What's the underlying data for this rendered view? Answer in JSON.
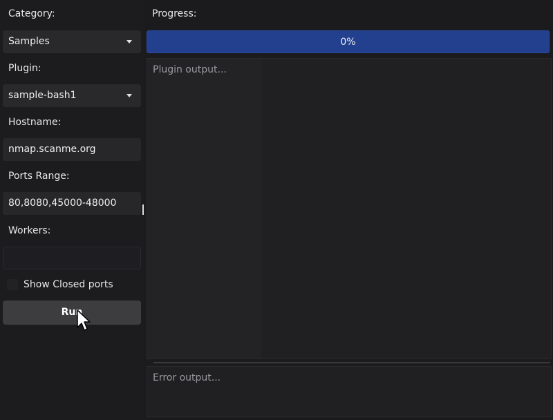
{
  "form": {
    "category_label": "Category:",
    "category_value": "Samples",
    "plugin_label": "Plugin:",
    "plugin_value": "sample-bash1",
    "hostname_label": "Hostname:",
    "hostname_value": "nmap.scanme.org",
    "ports_label": "Ports Range:",
    "ports_value": "80,8080,45000-48000",
    "workers_label": "Workers:",
    "workers_value": "",
    "show_closed_label": "Show Closed ports",
    "show_closed_checked": false,
    "run_label": "Run"
  },
  "output": {
    "progress_label": "Progress:",
    "progress_text": "0%",
    "progress_value": 0,
    "plugin_output_placeholder": "Plugin output...",
    "error_output_placeholder": "Error output..."
  },
  "colors": {
    "progress_bar": "#23408e",
    "background": "#1b1b1d",
    "button": "#3d3d40"
  }
}
